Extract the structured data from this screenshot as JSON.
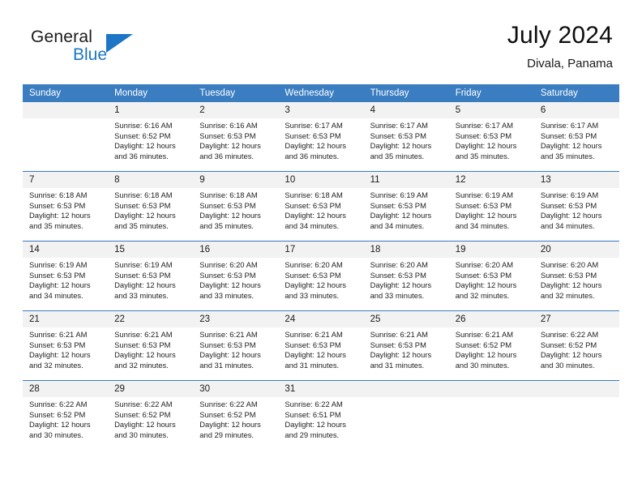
{
  "brand": {
    "name_part1": "General",
    "name_part2": "Blue",
    "triangle_color": "#1c76c5"
  },
  "header": {
    "title": "July 2024",
    "subtitle": "Divala, Panama",
    "header_bg_color": "#3a7dc0",
    "daynum_bg_color": "#f2f2f2"
  },
  "weekday_headers": [
    "Sunday",
    "Monday",
    "Tuesday",
    "Wednesday",
    "Thursday",
    "Friday",
    "Saturday"
  ],
  "labels": {
    "sunrise_prefix": "Sunrise:",
    "sunset_prefix": "Sunset:",
    "daylight_prefix": "Daylight:"
  },
  "weeks": [
    [
      {
        "day": "",
        "sunrise": "",
        "sunset": "",
        "daylight_line1": "",
        "daylight_line2": "",
        "empty": true
      },
      {
        "day": "1",
        "sunrise": "Sunrise: 6:16 AM",
        "sunset": "Sunset: 6:52 PM",
        "daylight_line1": "Daylight: 12 hours",
        "daylight_line2": "and 36 minutes."
      },
      {
        "day": "2",
        "sunrise": "Sunrise: 6:16 AM",
        "sunset": "Sunset: 6:53 PM",
        "daylight_line1": "Daylight: 12 hours",
        "daylight_line2": "and 36 minutes."
      },
      {
        "day": "3",
        "sunrise": "Sunrise: 6:17 AM",
        "sunset": "Sunset: 6:53 PM",
        "daylight_line1": "Daylight: 12 hours",
        "daylight_line2": "and 36 minutes."
      },
      {
        "day": "4",
        "sunrise": "Sunrise: 6:17 AM",
        "sunset": "Sunset: 6:53 PM",
        "daylight_line1": "Daylight: 12 hours",
        "daylight_line2": "and 35 minutes."
      },
      {
        "day": "5",
        "sunrise": "Sunrise: 6:17 AM",
        "sunset": "Sunset: 6:53 PM",
        "daylight_line1": "Daylight: 12 hours",
        "daylight_line2": "and 35 minutes."
      },
      {
        "day": "6",
        "sunrise": "Sunrise: 6:17 AM",
        "sunset": "Sunset: 6:53 PM",
        "daylight_line1": "Daylight: 12 hours",
        "daylight_line2": "and 35 minutes."
      }
    ],
    [
      {
        "day": "7",
        "sunrise": "Sunrise: 6:18 AM",
        "sunset": "Sunset: 6:53 PM",
        "daylight_line1": "Daylight: 12 hours",
        "daylight_line2": "and 35 minutes."
      },
      {
        "day": "8",
        "sunrise": "Sunrise: 6:18 AM",
        "sunset": "Sunset: 6:53 PM",
        "daylight_line1": "Daylight: 12 hours",
        "daylight_line2": "and 35 minutes."
      },
      {
        "day": "9",
        "sunrise": "Sunrise: 6:18 AM",
        "sunset": "Sunset: 6:53 PM",
        "daylight_line1": "Daylight: 12 hours",
        "daylight_line2": "and 35 minutes."
      },
      {
        "day": "10",
        "sunrise": "Sunrise: 6:18 AM",
        "sunset": "Sunset: 6:53 PM",
        "daylight_line1": "Daylight: 12 hours",
        "daylight_line2": "and 34 minutes."
      },
      {
        "day": "11",
        "sunrise": "Sunrise: 6:19 AM",
        "sunset": "Sunset: 6:53 PM",
        "daylight_line1": "Daylight: 12 hours",
        "daylight_line2": "and 34 minutes."
      },
      {
        "day": "12",
        "sunrise": "Sunrise: 6:19 AM",
        "sunset": "Sunset: 6:53 PM",
        "daylight_line1": "Daylight: 12 hours",
        "daylight_line2": "and 34 minutes."
      },
      {
        "day": "13",
        "sunrise": "Sunrise: 6:19 AM",
        "sunset": "Sunset: 6:53 PM",
        "daylight_line1": "Daylight: 12 hours",
        "daylight_line2": "and 34 minutes."
      }
    ],
    [
      {
        "day": "14",
        "sunrise": "Sunrise: 6:19 AM",
        "sunset": "Sunset: 6:53 PM",
        "daylight_line1": "Daylight: 12 hours",
        "daylight_line2": "and 34 minutes."
      },
      {
        "day": "15",
        "sunrise": "Sunrise: 6:19 AM",
        "sunset": "Sunset: 6:53 PM",
        "daylight_line1": "Daylight: 12 hours",
        "daylight_line2": "and 33 minutes."
      },
      {
        "day": "16",
        "sunrise": "Sunrise: 6:20 AM",
        "sunset": "Sunset: 6:53 PM",
        "daylight_line1": "Daylight: 12 hours",
        "daylight_line2": "and 33 minutes."
      },
      {
        "day": "17",
        "sunrise": "Sunrise: 6:20 AM",
        "sunset": "Sunset: 6:53 PM",
        "daylight_line1": "Daylight: 12 hours",
        "daylight_line2": "and 33 minutes."
      },
      {
        "day": "18",
        "sunrise": "Sunrise: 6:20 AM",
        "sunset": "Sunset: 6:53 PM",
        "daylight_line1": "Daylight: 12 hours",
        "daylight_line2": "and 33 minutes."
      },
      {
        "day": "19",
        "sunrise": "Sunrise: 6:20 AM",
        "sunset": "Sunset: 6:53 PM",
        "daylight_line1": "Daylight: 12 hours",
        "daylight_line2": "and 32 minutes."
      },
      {
        "day": "20",
        "sunrise": "Sunrise: 6:20 AM",
        "sunset": "Sunset: 6:53 PM",
        "daylight_line1": "Daylight: 12 hours",
        "daylight_line2": "and 32 minutes."
      }
    ],
    [
      {
        "day": "21",
        "sunrise": "Sunrise: 6:21 AM",
        "sunset": "Sunset: 6:53 PM",
        "daylight_line1": "Daylight: 12 hours",
        "daylight_line2": "and 32 minutes."
      },
      {
        "day": "22",
        "sunrise": "Sunrise: 6:21 AM",
        "sunset": "Sunset: 6:53 PM",
        "daylight_line1": "Daylight: 12 hours",
        "daylight_line2": "and 32 minutes."
      },
      {
        "day": "23",
        "sunrise": "Sunrise: 6:21 AM",
        "sunset": "Sunset: 6:53 PM",
        "daylight_line1": "Daylight: 12 hours",
        "daylight_line2": "and 31 minutes."
      },
      {
        "day": "24",
        "sunrise": "Sunrise: 6:21 AM",
        "sunset": "Sunset: 6:53 PM",
        "daylight_line1": "Daylight: 12 hours",
        "daylight_line2": "and 31 minutes."
      },
      {
        "day": "25",
        "sunrise": "Sunrise: 6:21 AM",
        "sunset": "Sunset: 6:53 PM",
        "daylight_line1": "Daylight: 12 hours",
        "daylight_line2": "and 31 minutes."
      },
      {
        "day": "26",
        "sunrise": "Sunrise: 6:21 AM",
        "sunset": "Sunset: 6:52 PM",
        "daylight_line1": "Daylight: 12 hours",
        "daylight_line2": "and 30 minutes."
      },
      {
        "day": "27",
        "sunrise": "Sunrise: 6:22 AM",
        "sunset": "Sunset: 6:52 PM",
        "daylight_line1": "Daylight: 12 hours",
        "daylight_line2": "and 30 minutes."
      }
    ],
    [
      {
        "day": "28",
        "sunrise": "Sunrise: 6:22 AM",
        "sunset": "Sunset: 6:52 PM",
        "daylight_line1": "Daylight: 12 hours",
        "daylight_line2": "and 30 minutes."
      },
      {
        "day": "29",
        "sunrise": "Sunrise: 6:22 AM",
        "sunset": "Sunset: 6:52 PM",
        "daylight_line1": "Daylight: 12 hours",
        "daylight_line2": "and 30 minutes."
      },
      {
        "day": "30",
        "sunrise": "Sunrise: 6:22 AM",
        "sunset": "Sunset: 6:52 PM",
        "daylight_line1": "Daylight: 12 hours",
        "daylight_line2": "and 29 minutes."
      },
      {
        "day": "31",
        "sunrise": "Sunrise: 6:22 AM",
        "sunset": "Sunset: 6:51 PM",
        "daylight_line1": "Daylight: 12 hours",
        "daylight_line2": "and 29 minutes."
      },
      {
        "day": "",
        "sunrise": "",
        "sunset": "",
        "daylight_line1": "",
        "daylight_line2": "",
        "empty": true
      },
      {
        "day": "",
        "sunrise": "",
        "sunset": "",
        "daylight_line1": "",
        "daylight_line2": "",
        "empty": true
      },
      {
        "day": "",
        "sunrise": "",
        "sunset": "",
        "daylight_line1": "",
        "daylight_line2": "",
        "empty": true
      }
    ]
  ]
}
